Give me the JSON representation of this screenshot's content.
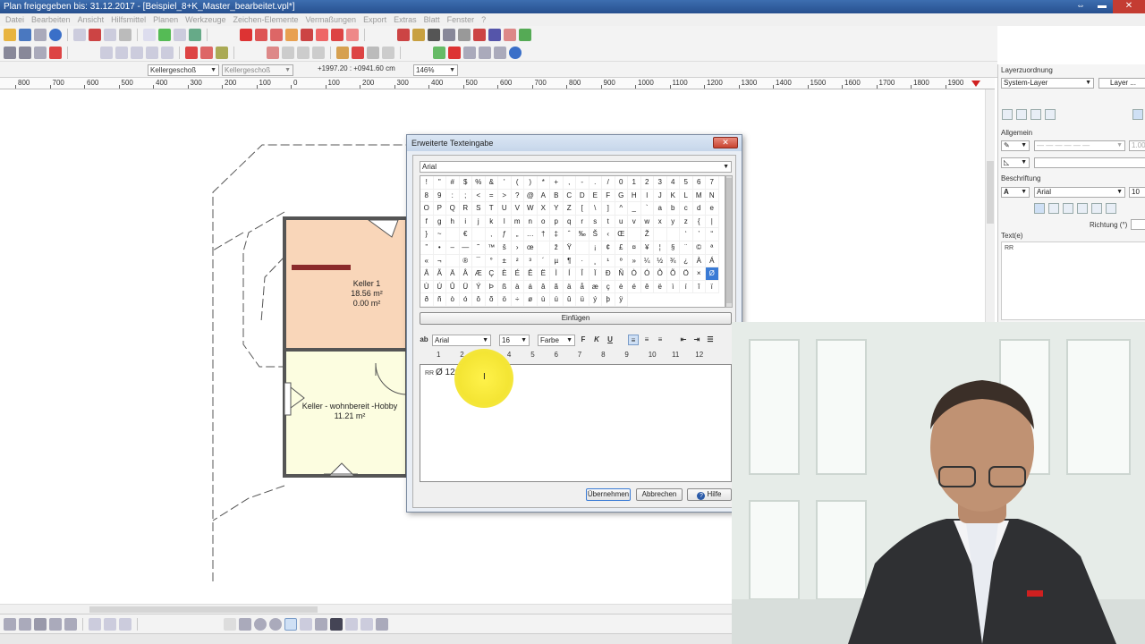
{
  "window": {
    "title": "Plan freigegeben bis: 31.12.2017 - [Beispiel_8+K_Master_bearbeitet.vpl*]"
  },
  "menu": [
    "Datei",
    "Bearbeiten",
    "Ansicht",
    "Hilfsmittel",
    "Planen",
    "Werkzeuge",
    "Zeichen-Elemente",
    "Vermaßungen",
    "Export",
    "Extras",
    "Blatt",
    "Fenster",
    "?"
  ],
  "planbar": {
    "floor_select": "Kellergeschoß",
    "floor_select2": "Kellergeschoß",
    "coordinates": "+1997.20 : +0941.60 cm",
    "zoom": "146%"
  },
  "ruler": {
    "ticks": [
      "800",
      "700",
      "600",
      "500",
      "400",
      "300",
      "200",
      "100",
      "0",
      "100",
      "200",
      "300",
      "400",
      "500",
      "600",
      "700",
      "800",
      "900",
      "1000",
      "1100",
      "1200",
      "1300",
      "1400",
      "1500",
      "1600",
      "1700",
      "1800",
      "1900"
    ]
  },
  "plan": {
    "rooms": [
      {
        "name": "Keller 1",
        "area": "18.56 m²",
        "extra": "0.00 m²",
        "fill": "#f9d6b9"
      },
      {
        "name": "Keller - wohnbereit -Hobby",
        "area": "11.21 m²",
        "fill": "#fcfde0"
      }
    ]
  },
  "dialog": {
    "title": "Erweiterte Texteingabe",
    "close_label": "✕",
    "font": "Arial",
    "charset": [
      "!",
      "\"",
      "#",
      "$",
      "%",
      "&",
      "'",
      "(",
      ")",
      "*",
      "+",
      ",",
      "-",
      ".",
      "/",
      "0",
      "1",
      "2",
      "3",
      "4",
      "5",
      "6",
      "7",
      "8",
      "9",
      ":",
      ";",
      "<",
      "=",
      ">",
      "?",
      "@",
      "A",
      "B",
      "C",
      "D",
      "E",
      "F",
      "G",
      "H",
      "I",
      "J",
      "K",
      "L",
      "M",
      "N",
      "O",
      "P",
      "Q",
      "R",
      "S",
      "T",
      "U",
      "V",
      "W",
      "X",
      "Y",
      "Z",
      "[",
      "\\",
      "]",
      "^",
      "_",
      "`",
      "a",
      "b",
      "c",
      "d",
      "e",
      "f",
      "g",
      "h",
      "i",
      "j",
      "k",
      "l",
      "m",
      "n",
      "o",
      "p",
      "q",
      "r",
      "s",
      "t",
      "u",
      "v",
      "w",
      "x",
      "y",
      "z",
      "{",
      "|",
      "}",
      "~",
      "",
      "€",
      "",
      "‚",
      "ƒ",
      "„",
      "…",
      "†",
      "‡",
      "ˆ",
      "‰",
      "Š",
      "‹",
      "Œ",
      "",
      "Ž",
      "",
      "",
      "‘",
      "’",
      "“",
      "”",
      "•",
      "–",
      "—",
      "˜",
      "™",
      "š",
      "›",
      "œ",
      "",
      "ž",
      "Ÿ",
      " ",
      "¡",
      "¢",
      "£",
      "¤",
      "¥",
      "¦",
      "§",
      "¨",
      "©",
      "ª",
      "«",
      "¬",
      "",
      "®",
      "¯",
      "°",
      "±",
      "²",
      "³",
      "´",
      "µ",
      "¶",
      "·",
      "¸",
      "¹",
      "º",
      "»",
      "¼",
      "½",
      "¾",
      "¿",
      "À",
      "Á",
      "Â",
      "Ã",
      "Ä",
      "Å",
      "Æ",
      "Ç",
      "È",
      "É",
      "Ê",
      "Ë",
      "Ì",
      "Í",
      "Î",
      "Ï",
      "Ð",
      "Ñ",
      "Ò",
      "Ó",
      "Ô",
      "Õ",
      "Ö",
      "×",
      "Ø",
      "Ù",
      "Ú",
      "Û",
      "Ü",
      "Ý",
      "Þ",
      "ß",
      "à",
      "á",
      "â",
      "ã",
      "ä",
      "å",
      "æ",
      "ç",
      "è",
      "é",
      "ê",
      "ë",
      "ì",
      "í",
      "î",
      "ï",
      "ð",
      "ñ",
      "ò",
      "ó",
      "ô",
      "õ",
      "ö",
      "÷",
      "ø",
      "ù",
      "ú",
      "û",
      "ü",
      "ý",
      "þ",
      "ÿ"
    ],
    "selected_char": "Ø",
    "insert_button": "Einfügen",
    "format": {
      "font": "Arial",
      "size": "16",
      "color": "Farbe"
    },
    "text_ruler": [
      "1",
      "2",
      "3",
      "4",
      "5",
      "6",
      "7",
      "8",
      "9",
      "10",
      "11",
      "12"
    ],
    "text_prefix": "RR",
    "text_value": "Ø 120",
    "buttons": {
      "ok": "Übernehmen",
      "cancel": "Abbrechen",
      "help": "Hilfe"
    }
  },
  "right_panel": {
    "title": "Layerzuordnung",
    "layer_select": "System-Layer",
    "layer_button": "Layer ...",
    "section_general": "Allgemein",
    "line_value": "1.00",
    "section_label": "Beschriftung",
    "label_font": "Arial",
    "label_size": "10",
    "direction_label": "Richtung (°)",
    "text_label": "Text(e)",
    "text_value": "RR"
  }
}
